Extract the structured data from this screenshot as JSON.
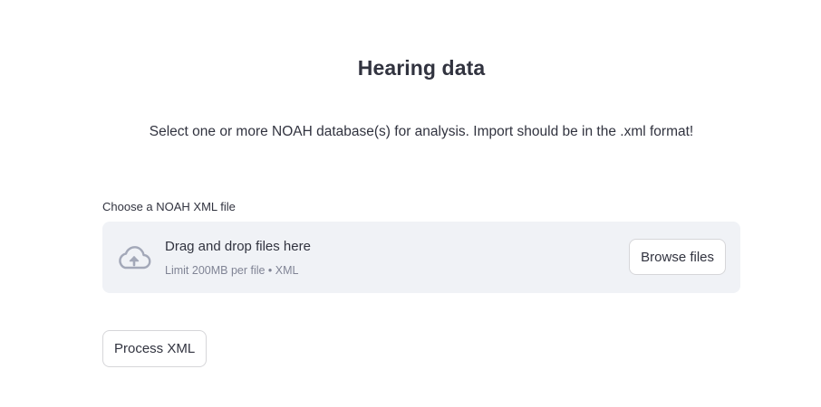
{
  "header": {
    "title": "Hearing data",
    "subtitle": "Select one or more NOAH database(s) for analysis. Import should be in the .xml format!"
  },
  "uploader": {
    "label": "Choose a NOAH XML file",
    "icon": "cloud-upload-icon",
    "drop_text": "Drag and drop files here",
    "limit_text": "Limit 200MB per file • XML",
    "browse_label": "Browse files"
  },
  "actions": {
    "process_label": "Process XML"
  },
  "colors": {
    "text": "#31333f",
    "muted": "#808495",
    "dropzone_bg": "#f0f2f6",
    "border": "#d6d6d9",
    "icon": "#a3a8b8"
  }
}
